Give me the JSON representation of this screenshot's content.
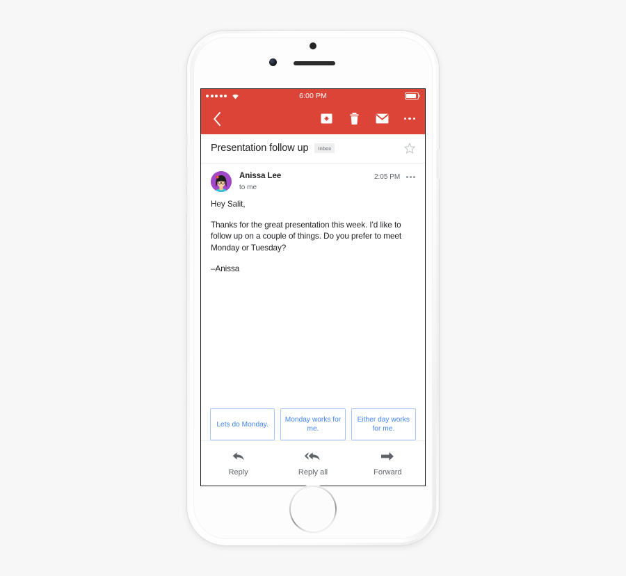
{
  "device": {
    "name": "iphone-silver",
    "camera_icon": "front-camera-icon",
    "speaker_icon": "earpiece-speaker-icon",
    "sensor_icon": "proximity-sensor-icon",
    "home_button": "home-button"
  },
  "colors": {
    "app_bar_red": "#DB4437",
    "smart_reply_blue": "#4285F4",
    "smart_reply_border": "#A6C4F7",
    "avatar_purple": "#A347C9",
    "page_background": "#F7F7F7",
    "primary_text": "#202124",
    "secondary_text": "#5F6368"
  },
  "status_bar": {
    "signal_dots": 5,
    "wifi_icon": "wifi-icon",
    "time": "6:00 PM",
    "battery_icon": "battery-icon",
    "battery_level_percent": 88
  },
  "app_bar": {
    "back_icon": "chevron-left-icon",
    "actions": [
      {
        "name": "archive-button",
        "icon": "archive-icon"
      },
      {
        "name": "delete-button",
        "icon": "trash-icon"
      },
      {
        "name": "mark-unread-button",
        "icon": "envelope-icon"
      },
      {
        "name": "more-options-button",
        "icon": "overflow-menu-icon"
      }
    ]
  },
  "subject": {
    "title": "Presentation follow up",
    "label": "Inbox",
    "star_icon": "star-outline-icon"
  },
  "message": {
    "sender_name": "Anissa Lee",
    "recipient": "to me",
    "time": "2:05 PM",
    "overflow_icon": "overflow-menu-icon",
    "avatar_icon": "avatar",
    "body_paragraphs": [
      "Hey Salit,",
      "Thanks for the great presentation this week. I'd like to follow up on a couple of things. Do you prefer to meet Monday or Tuesday?",
      "–Anissa"
    ]
  },
  "smart_replies": [
    {
      "label": "Lets do Monday."
    },
    {
      "label": "Monday works for me."
    },
    {
      "label": "Either day works for me."
    }
  ],
  "action_bar": [
    {
      "label": "Reply",
      "icon": "reply-arrow-icon"
    },
    {
      "label": "Reply all",
      "icon": "reply-all-arrow-icon"
    },
    {
      "label": "Forward",
      "icon": "forward-arrow-icon"
    }
  ]
}
